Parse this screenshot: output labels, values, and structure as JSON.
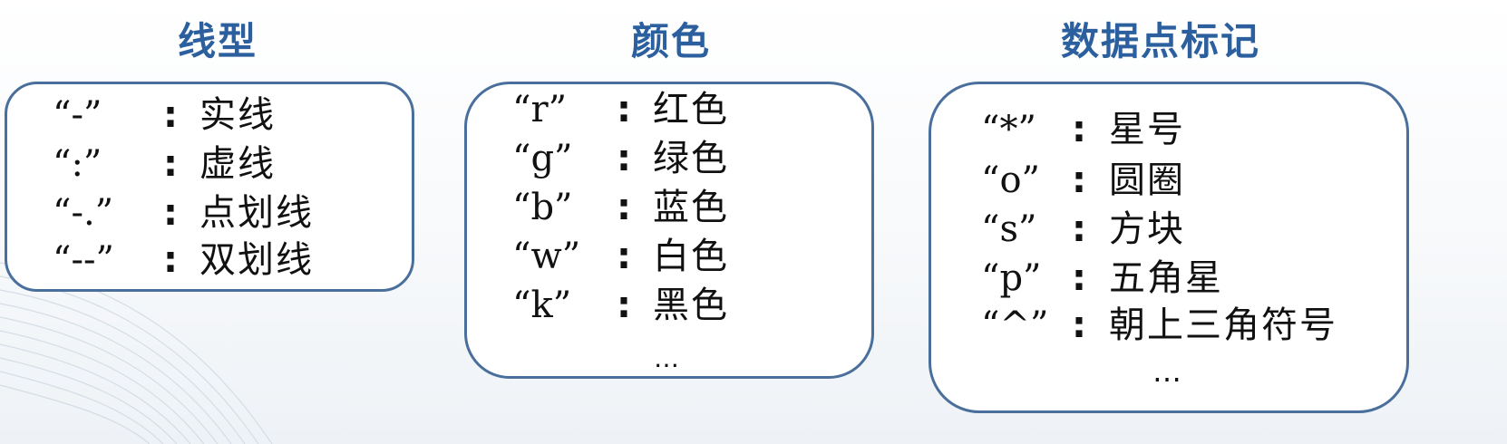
{
  "line_style": {
    "title": "线型",
    "items": [
      {
        "code": "“-”",
        "colon": ":",
        "desc": "实线"
      },
      {
        "code": "“:”",
        "colon": ":",
        "desc": "虚线"
      },
      {
        "code": "“-.”",
        "colon": ":",
        "desc": "点划线"
      },
      {
        "code": "“--”",
        "colon": ":",
        "desc": "双划线"
      }
    ]
  },
  "color": {
    "title": "颜色",
    "items": [
      {
        "code": "“r”",
        "colon": ":",
        "desc": "红色"
      },
      {
        "code": "“g”",
        "colon": ":",
        "desc": "绿色"
      },
      {
        "code": "“b”",
        "colon": ":",
        "desc": "蓝色"
      },
      {
        "code": "“w”",
        "colon": ":",
        "desc": "白色"
      },
      {
        "code": "“k”",
        "colon": ":",
        "desc": "黑色"
      }
    ],
    "ellipsis": "…"
  },
  "marker": {
    "title": "数据点标记",
    "items": [
      {
        "code": "“*”",
        "colon": ":",
        "desc": "星号"
      },
      {
        "code": "“o”",
        "colon": ":",
        "desc": "圆圈"
      },
      {
        "code": "“s”",
        "colon": ":",
        "desc": "方块"
      },
      {
        "code": "“p”",
        "colon": ":",
        "desc": "五角星"
      },
      {
        "code": "“^”",
        "colon": ":",
        "desc": "朝上三角符号"
      }
    ],
    "ellipsis": "…"
  }
}
